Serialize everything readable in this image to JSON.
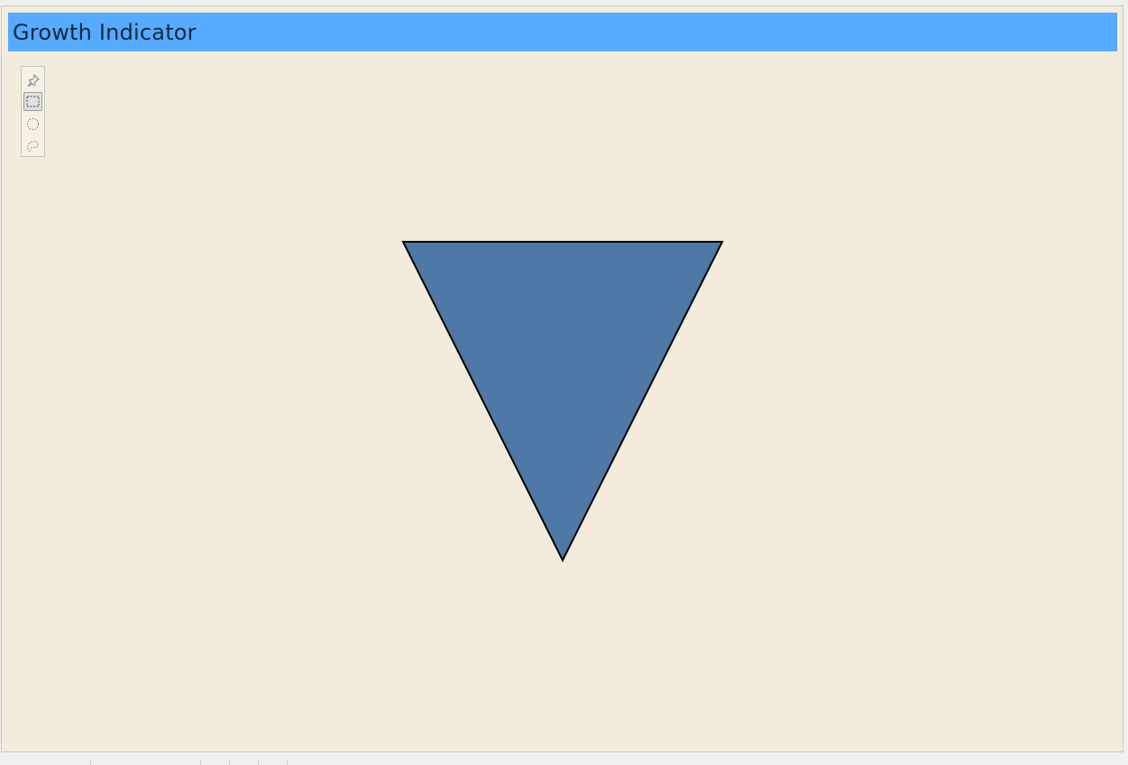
{
  "window": {
    "title": "Growth Indicator"
  },
  "colors": {
    "title_bar": "#56aaff",
    "canvas_background": "#f3ecdc",
    "indicator_fill": "#4e79a7",
    "indicator_stroke": "#000000"
  },
  "toolbar": {
    "tools": [
      {
        "icon": "pin-icon",
        "active": false
      },
      {
        "icon": "box-select-icon",
        "active": true
      },
      {
        "icon": "circle-select-icon",
        "active": false
      },
      {
        "icon": "lasso-select-icon",
        "active": false
      }
    ]
  },
  "indicator": {
    "shape": "triangle-down"
  }
}
